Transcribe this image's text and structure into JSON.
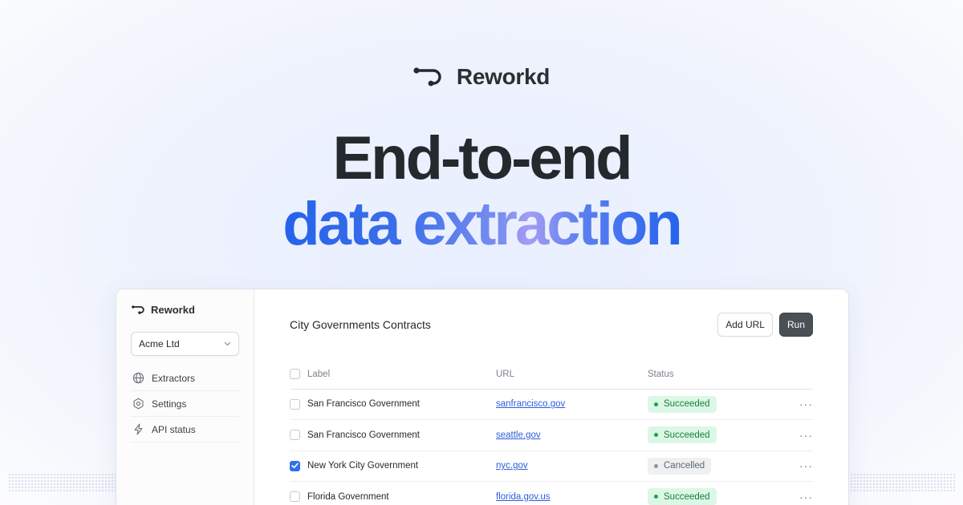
{
  "brand": {
    "name": "Reworkd"
  },
  "hero": {
    "line1": "End-to-end",
    "line2": "data extraction"
  },
  "app": {
    "brand_name": "Reworkd",
    "org_select": {
      "value": "Acme Ltd"
    },
    "nav": [
      {
        "label": "Extractors",
        "icon": "globe-icon"
      },
      {
        "label": "Settings",
        "icon": "gear-icon"
      },
      {
        "label": "API status",
        "icon": "lightning-icon"
      }
    ],
    "title": "City Governments Contracts",
    "add_url_label": "Add URL",
    "run_label": "Run",
    "table": {
      "headers": {
        "label": "Label",
        "url": "URL",
        "status": "Status"
      },
      "rows": [
        {
          "label": "San Francisco Government",
          "url": "sanfrancisco.gov",
          "status": "Succeeded",
          "checked": false
        },
        {
          "label": "San Francisco Government",
          "url": "seattle.gov",
          "status": "Succeeded",
          "checked": false
        },
        {
          "label": "New York City Government",
          "url": "nyc.gov",
          "status": "Cancelled",
          "checked": true
        },
        {
          "label": "Florida Government",
          "url": "florida.gov.us",
          "status": "Succeeded",
          "checked": false
        }
      ],
      "row_menu_glyph": "···"
    }
  },
  "colors": {
    "accent": "#2563eb",
    "success_bg": "#dcf7e6",
    "success_text": "#17803d",
    "cancel_bg": "#eef0f2",
    "run_button": "#4a5056"
  }
}
